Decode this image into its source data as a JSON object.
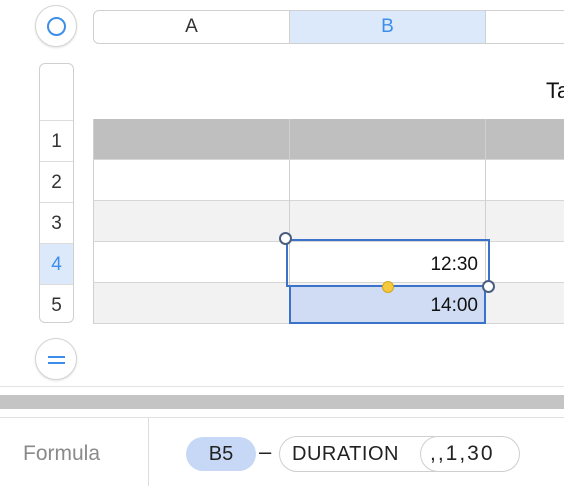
{
  "columns": [
    {
      "letter": "A",
      "selected": false
    },
    {
      "letter": "B",
      "selected": true
    }
  ],
  "rows": [
    {
      "number": "1",
      "selected": false
    },
    {
      "number": "2",
      "selected": false
    },
    {
      "number": "3",
      "selected": false
    },
    {
      "number": "4",
      "selected": true
    },
    {
      "number": "5",
      "selected": false
    }
  ],
  "table": {
    "title_partial": "Ta",
    "cells": {
      "B4": "12:30",
      "B5": "14:00"
    }
  },
  "formula_bar": {
    "label": "Formula",
    "reference": "B5",
    "operator": "–",
    "function_name": "DURATION",
    "arguments": ",,1,30"
  },
  "colors": {
    "accent": "#3d8ee8",
    "selection_fill": "#cfdcf3",
    "selection_border": "#3b73c8",
    "header_row": "#bfbfbf",
    "reference_token": "#c6d8f5"
  }
}
